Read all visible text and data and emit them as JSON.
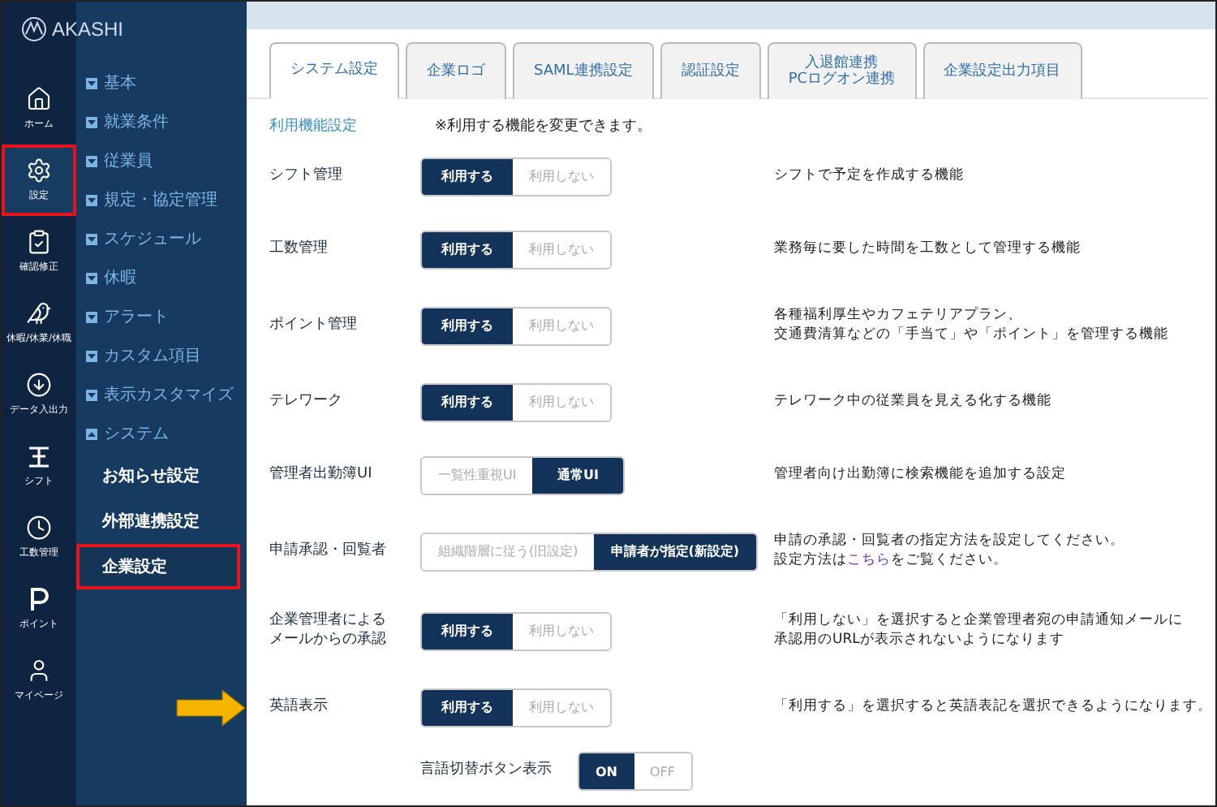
{
  "logo": {
    "text": "AKASHI"
  },
  "rail": [
    {
      "label": "ホーム",
      "selected": false,
      "highlighted": false
    },
    {
      "label": "設定",
      "selected": true,
      "highlighted": true
    },
    {
      "label": "確認修正",
      "selected": false,
      "highlighted": false
    },
    {
      "label": "休暇/休業/休職",
      "selected": false,
      "highlighted": false
    },
    {
      "label": "データ入出力",
      "selected": false,
      "highlighted": false
    },
    {
      "label": "シフト",
      "selected": false,
      "highlighted": false
    },
    {
      "label": "工数管理",
      "selected": false,
      "highlighted": false
    },
    {
      "label": "ポイント",
      "selected": false,
      "highlighted": false
    },
    {
      "label": "マイページ",
      "selected": false,
      "highlighted": false
    }
  ],
  "menu": [
    {
      "label": "基本",
      "expanded": false
    },
    {
      "label": "就業条件",
      "expanded": false
    },
    {
      "label": "従業員",
      "expanded": false
    },
    {
      "label": "規定・協定管理",
      "expanded": false
    },
    {
      "label": "スケジュール",
      "expanded": false
    },
    {
      "label": "休暇",
      "expanded": false
    },
    {
      "label": "アラート",
      "expanded": false
    },
    {
      "label": "カスタム項目",
      "expanded": false
    },
    {
      "label": "表示カスタマイズ",
      "expanded": false
    },
    {
      "label": "システム",
      "expanded": true,
      "children": [
        {
          "label": "お知らせ設定",
          "selected": false,
          "highlighted": false
        },
        {
          "label": "外部連携設定",
          "selected": false,
          "highlighted": false
        },
        {
          "label": "企業設定",
          "selected": true,
          "highlighted": true
        }
      ]
    }
  ],
  "tabs": [
    {
      "lines": [
        "システム設定"
      ],
      "selected": true
    },
    {
      "lines": [
        "企業ロゴ"
      ],
      "selected": false
    },
    {
      "lines": [
        "SAML連携設定"
      ],
      "selected": false
    },
    {
      "lines": [
        "認証設定"
      ],
      "selected": false
    },
    {
      "lines": [
        "入退館連携",
        "PCログオン連携"
      ],
      "selected": false
    },
    {
      "lines": [
        "企業設定出力項目"
      ],
      "selected": false
    }
  ],
  "section": {
    "title": "利用機能設定",
    "note": "※利用する機能を変更できます。"
  },
  "rows": [
    {
      "label": [
        "シフト管理"
      ],
      "options": [
        {
          "label": "利用する",
          "selected": true
        },
        {
          "label": "利用しない",
          "selected": false
        }
      ],
      "description": [
        {
          "text": "シフトで予定を作成する機能"
        }
      ]
    },
    {
      "label": [
        "工数管理"
      ],
      "options": [
        {
          "label": "利用する",
          "selected": true
        },
        {
          "label": "利用しない",
          "selected": false
        }
      ],
      "description": [
        {
          "text": "業務毎に要した時間を工数として管理する機能"
        }
      ]
    },
    {
      "label": [
        "ポイント管理"
      ],
      "options": [
        {
          "label": "利用する",
          "selected": true
        },
        {
          "label": "利用しない",
          "selected": false
        }
      ],
      "description": [
        {
          "text": "各種福利厚生やカフェテリアプラン、"
        },
        {
          "text": "交通費清算などの「手当て」や「ポイント」を管理する機能"
        }
      ]
    },
    {
      "label": [
        "テレワーク"
      ],
      "options": [
        {
          "label": "利用する",
          "selected": true
        },
        {
          "label": "利用しない",
          "selected": false
        }
      ],
      "description": [
        {
          "text": "テレワーク中の従業員を見える化する機能"
        }
      ]
    },
    {
      "label": [
        "管理者出勤簿UI"
      ],
      "options": [
        {
          "label": "一覧性重視UI",
          "selected": false
        },
        {
          "label": "通常UI",
          "selected": true
        }
      ],
      "description": [
        {
          "text": "管理者向け出勤簿に検索機能を追加する設定"
        }
      ]
    },
    {
      "label": [
        "申請承認・回覧者"
      ],
      "options": [
        {
          "label": "組織階層に従う(旧設定)",
          "selected": false
        },
        {
          "label": "申請者が指定(新設定)",
          "selected": true
        }
      ],
      "description": [
        {
          "text": "申請の承認・回覧者の指定方法を設定してください。"
        },
        {
          "text": "設定方法は",
          "link": "こちら",
          "after": "をご覧ください。"
        }
      ]
    },
    {
      "label": [
        "企業管理者による",
        "メールからの承認"
      ],
      "options": [
        {
          "label": "利用する",
          "selected": true
        },
        {
          "label": "利用しない",
          "selected": false
        }
      ],
      "description": [
        {
          "text": "「利用しない」を選択すると企業管理者宛の申請通知メールに"
        },
        {
          "text": "承認用のURLが表示されないようになります"
        }
      ]
    },
    {
      "label": [
        "英語表示"
      ],
      "pointer": true,
      "options": [
        {
          "label": "利用する",
          "selected": true
        },
        {
          "label": "利用しない",
          "selected": false
        }
      ],
      "description": [
        {
          "text": "「利用する」を選択すると英語表記を選択できるようになります。"
        }
      ],
      "sub": {
        "label": "言語切替ボタン表示",
        "options": [
          {
            "label": "ON",
            "selected": true
          },
          {
            "label": "OFF",
            "selected": false
          }
        ]
      }
    }
  ]
}
